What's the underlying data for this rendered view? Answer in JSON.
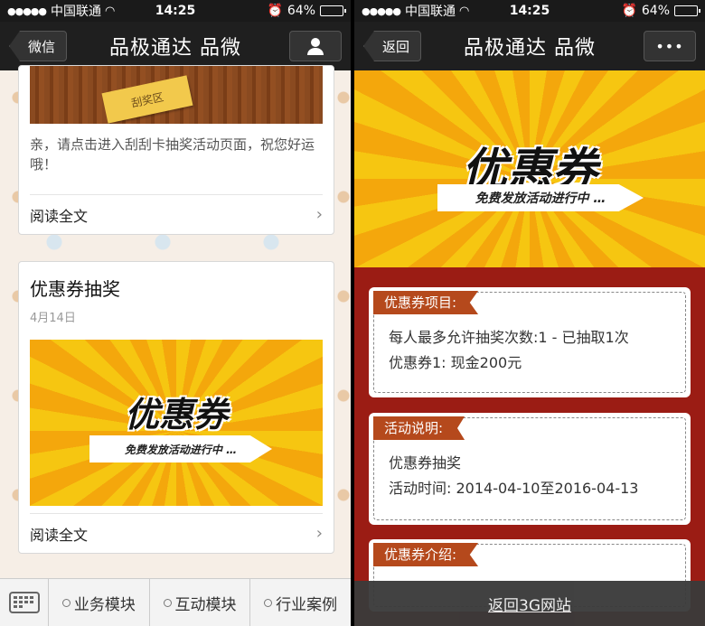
{
  "status": {
    "carrier": "中国联通",
    "time": "14:25",
    "battery": "64%",
    "battery_level": 0.64
  },
  "left": {
    "nav": {
      "back": "微信",
      "title": "品极通达 品微"
    },
    "card1": {
      "scratch_tag": "刮奖区",
      "text": "亲，请点击进入刮刮卡抽奖活动页面，祝您好运哦！",
      "read_more": "阅读全文"
    },
    "card2": {
      "title": "优惠券抽奖",
      "date": "4月14日",
      "banner_logo": "优惠券",
      "banner_tagline": "免费发放活动进行中 …",
      "read_more": "阅读全文"
    },
    "menu": [
      "业务模块",
      "互动模块",
      "行业案例"
    ]
  },
  "right": {
    "nav": {
      "back": "返回",
      "title": "品极通达 品微",
      "more": "•••"
    },
    "banner_logo": "优惠券",
    "banner_tagline": "免费发放活动进行中 …",
    "sections": [
      {
        "label": "优惠券项目:",
        "lines": [
          "每人最多允许抽奖次数:1 - 已抽取1次",
          "优惠券1: 现金200元"
        ]
      },
      {
        "label": "活动说明:",
        "lines": [
          "优惠券抽奖",
          "活动时间: 2014-04-10至2016-04-13"
        ]
      },
      {
        "label": "优惠券介绍:",
        "lines": []
      }
    ],
    "footer_link": "返回3G网站"
  }
}
